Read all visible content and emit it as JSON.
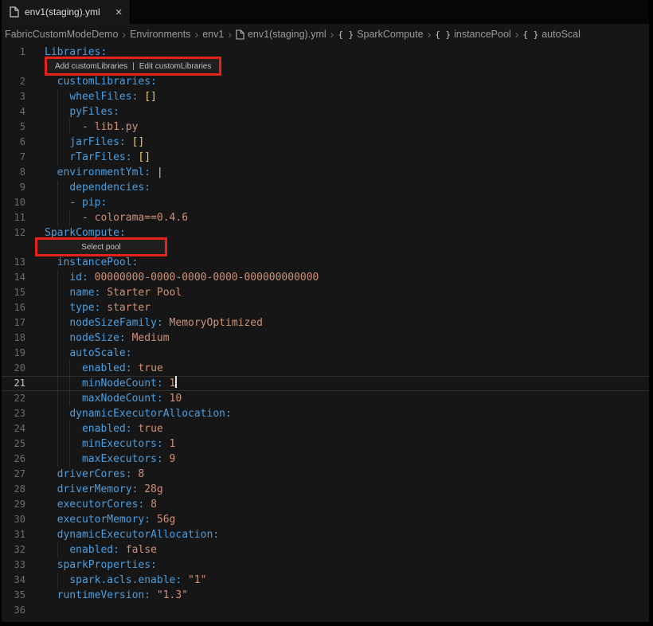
{
  "tab": {
    "title": "env1(staging).yml",
    "close_glyph": "×"
  },
  "breadcrumbs": {
    "separator": "›",
    "items": [
      {
        "label": "FabricCustomModeDemo",
        "icon": null
      },
      {
        "label": "Environments",
        "icon": null
      },
      {
        "label": "env1",
        "icon": null
      },
      {
        "label": "env1(staging).yml",
        "icon": "file"
      },
      {
        "label": "SparkCompute",
        "icon": "braces"
      },
      {
        "label": "instancePool",
        "icon": "braces"
      },
      {
        "label": "autoScal",
        "icon": "braces"
      }
    ]
  },
  "colors": {
    "key": "#4b9fe1",
    "value": "#ce9178",
    "bracket": "#efd06b",
    "annotation_red": "#e5231b",
    "editor_bg": "#161616",
    "tabbar_bg": "#060606"
  },
  "editor": {
    "cursor_line": 21,
    "codelens": [
      {
        "after_line": 1,
        "name": "custom-libraries-codelens",
        "style": "wide",
        "links": [
          "Add customLibraries",
          "Edit customLibraries"
        ],
        "separator": "|"
      },
      {
        "after_line": 12,
        "name": "select-pool-codelens",
        "style": "narrow",
        "links": [
          "Select pool"
        ],
        "separator": ""
      }
    ],
    "lines": [
      {
        "n": 1,
        "tokens": [
          [
            "key",
            "Libraries:"
          ]
        ]
      },
      {
        "n": 2,
        "tokens": [
          [
            "ws",
            "  "
          ],
          [
            "key",
            "customLibraries:"
          ]
        ]
      },
      {
        "n": 3,
        "tokens": [
          [
            "ws",
            "    "
          ],
          [
            "key",
            "wheelFiles:"
          ],
          [
            "ws",
            " "
          ],
          [
            "bracket",
            "[]"
          ]
        ]
      },
      {
        "n": 4,
        "tokens": [
          [
            "ws",
            "    "
          ],
          [
            "key",
            "pyFiles:"
          ]
        ]
      },
      {
        "n": 5,
        "tokens": [
          [
            "ws",
            "      "
          ],
          [
            "dash",
            "- "
          ],
          [
            "val",
            "lib1.py"
          ]
        ]
      },
      {
        "n": 6,
        "tokens": [
          [
            "ws",
            "    "
          ],
          [
            "key",
            "jarFiles:"
          ],
          [
            "ws",
            " "
          ],
          [
            "bracket",
            "[]"
          ]
        ]
      },
      {
        "n": 7,
        "tokens": [
          [
            "ws",
            "    "
          ],
          [
            "key",
            "rTarFiles:"
          ],
          [
            "ws",
            " "
          ],
          [
            "bracket",
            "[]"
          ]
        ]
      },
      {
        "n": 8,
        "tokens": [
          [
            "ws",
            "  "
          ],
          [
            "key",
            "environmentYml:"
          ],
          [
            "ws",
            " "
          ],
          [
            "punc",
            "|"
          ]
        ]
      },
      {
        "n": 9,
        "tokens": [
          [
            "ws",
            "    "
          ],
          [
            "key",
            "dependencies:"
          ]
        ]
      },
      {
        "n": 10,
        "tokens": [
          [
            "ws",
            "    "
          ],
          [
            "dash",
            "- "
          ],
          [
            "key",
            "pip:"
          ]
        ]
      },
      {
        "n": 11,
        "tokens": [
          [
            "ws",
            "      "
          ],
          [
            "dash",
            "- "
          ],
          [
            "val",
            "colorama==0.4.6"
          ]
        ]
      },
      {
        "n": 12,
        "tokens": [
          [
            "key",
            "SparkCompute:"
          ]
        ]
      },
      {
        "n": 13,
        "tokens": [
          [
            "ws",
            "  "
          ],
          [
            "key",
            "instancePool:"
          ]
        ]
      },
      {
        "n": 14,
        "tokens": [
          [
            "ws",
            "    "
          ],
          [
            "key",
            "id:"
          ],
          [
            "ws",
            " "
          ],
          [
            "val",
            "00000000-0000-0000-0000-000000000000"
          ]
        ]
      },
      {
        "n": 15,
        "tokens": [
          [
            "ws",
            "    "
          ],
          [
            "key",
            "name:"
          ],
          [
            "ws",
            " "
          ],
          [
            "val",
            "Starter Pool"
          ]
        ]
      },
      {
        "n": 16,
        "tokens": [
          [
            "ws",
            "    "
          ],
          [
            "key",
            "type:"
          ],
          [
            "ws",
            " "
          ],
          [
            "val",
            "starter"
          ]
        ]
      },
      {
        "n": 17,
        "tokens": [
          [
            "ws",
            "    "
          ],
          [
            "key",
            "nodeSizeFamily:"
          ],
          [
            "ws",
            " "
          ],
          [
            "val",
            "MemoryOptimized"
          ]
        ]
      },
      {
        "n": 18,
        "tokens": [
          [
            "ws",
            "    "
          ],
          [
            "key",
            "nodeSize:"
          ],
          [
            "ws",
            " "
          ],
          [
            "val",
            "Medium"
          ]
        ]
      },
      {
        "n": 19,
        "tokens": [
          [
            "ws",
            "    "
          ],
          [
            "key",
            "autoScale:"
          ]
        ]
      },
      {
        "n": 20,
        "tokens": [
          [
            "ws",
            "      "
          ],
          [
            "key",
            "enabled:"
          ],
          [
            "ws",
            " "
          ],
          [
            "val",
            "true"
          ]
        ]
      },
      {
        "n": 21,
        "tokens": [
          [
            "ws",
            "      "
          ],
          [
            "key",
            "minNodeCount:"
          ],
          [
            "ws",
            " "
          ],
          [
            "val",
            "1"
          ],
          [
            "cursor",
            ""
          ]
        ]
      },
      {
        "n": 22,
        "tokens": [
          [
            "ws",
            "      "
          ],
          [
            "key",
            "maxNodeCount:"
          ],
          [
            "ws",
            " "
          ],
          [
            "val",
            "10"
          ]
        ]
      },
      {
        "n": 23,
        "tokens": [
          [
            "ws",
            "    "
          ],
          [
            "key",
            "dynamicExecutorAllocation:"
          ]
        ]
      },
      {
        "n": 24,
        "tokens": [
          [
            "ws",
            "      "
          ],
          [
            "key",
            "enabled:"
          ],
          [
            "ws",
            " "
          ],
          [
            "val",
            "true"
          ]
        ]
      },
      {
        "n": 25,
        "tokens": [
          [
            "ws",
            "      "
          ],
          [
            "key",
            "minExecutors:"
          ],
          [
            "ws",
            " "
          ],
          [
            "val",
            "1"
          ]
        ]
      },
      {
        "n": 26,
        "tokens": [
          [
            "ws",
            "      "
          ],
          [
            "key",
            "maxExecutors:"
          ],
          [
            "ws",
            " "
          ],
          [
            "val",
            "9"
          ]
        ]
      },
      {
        "n": 27,
        "tokens": [
          [
            "ws",
            "  "
          ],
          [
            "key",
            "driverCores:"
          ],
          [
            "ws",
            " "
          ],
          [
            "val",
            "8"
          ]
        ]
      },
      {
        "n": 28,
        "tokens": [
          [
            "ws",
            "  "
          ],
          [
            "key",
            "driverMemory:"
          ],
          [
            "ws",
            " "
          ],
          [
            "val",
            "28g"
          ]
        ]
      },
      {
        "n": 29,
        "tokens": [
          [
            "ws",
            "  "
          ],
          [
            "key",
            "executorCores:"
          ],
          [
            "ws",
            " "
          ],
          [
            "val",
            "8"
          ]
        ]
      },
      {
        "n": 30,
        "tokens": [
          [
            "ws",
            "  "
          ],
          [
            "key",
            "executorMemory:"
          ],
          [
            "ws",
            " "
          ],
          [
            "val",
            "56g"
          ]
        ]
      },
      {
        "n": 31,
        "tokens": [
          [
            "ws",
            "  "
          ],
          [
            "key",
            "dynamicExecutorAllocation:"
          ]
        ]
      },
      {
        "n": 32,
        "tokens": [
          [
            "ws",
            "    "
          ],
          [
            "key",
            "enabled:"
          ],
          [
            "ws",
            " "
          ],
          [
            "val",
            "false"
          ]
        ]
      },
      {
        "n": 33,
        "tokens": [
          [
            "ws",
            "  "
          ],
          [
            "key",
            "sparkProperties:"
          ]
        ]
      },
      {
        "n": 34,
        "tokens": [
          [
            "ws",
            "    "
          ],
          [
            "key",
            "spark.acls.enable:"
          ],
          [
            "ws",
            " "
          ],
          [
            "val",
            "\"1\""
          ]
        ]
      },
      {
        "n": 35,
        "tokens": [
          [
            "ws",
            "  "
          ],
          [
            "key",
            "runtimeVersion:"
          ],
          [
            "ws",
            " "
          ],
          [
            "val",
            "\"1.3\""
          ]
        ]
      },
      {
        "n": 36,
        "tokens": []
      }
    ]
  }
}
